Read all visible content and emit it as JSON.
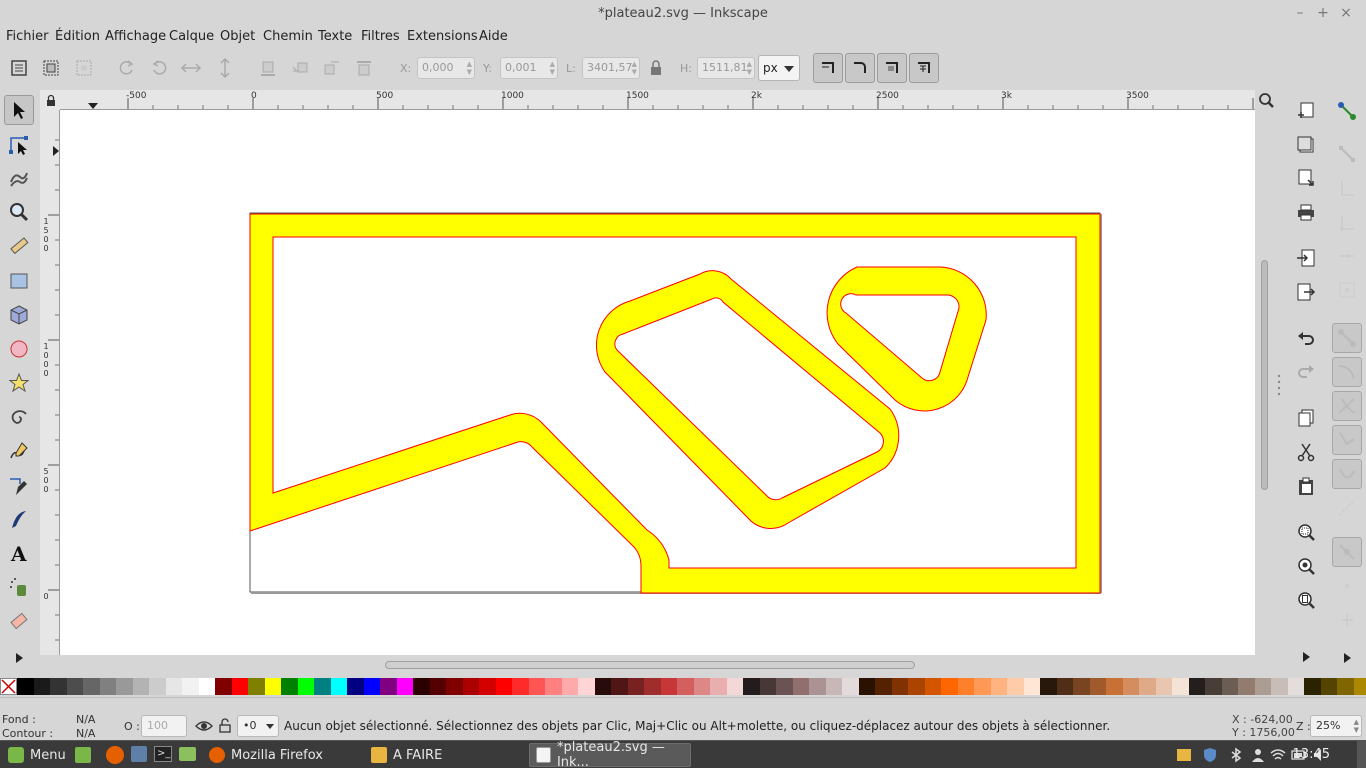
{
  "window": {
    "title": "*plateau2.svg — Inkscape",
    "controls": [
      "–",
      "+",
      "×"
    ]
  },
  "menu": [
    "Fichier",
    "Édition",
    "Affichage",
    "Calque",
    "Objet",
    "Chemin",
    "Texte",
    "Filtres",
    "Extensions",
    "Aide"
  ],
  "toolbar": {
    "x_label": "X:",
    "x_value": "0,000",
    "y_label": "Y:",
    "y_value": "0,001",
    "w_label": "L:",
    "w_value": "3401,57",
    "h_label": "H:",
    "h_value": "1511,81",
    "unit": "px"
  },
  "rulers": {
    "top": [
      "-500",
      "0",
      "500",
      "1000",
      "1500",
      "2k",
      "2500",
      "3k",
      "3500"
    ],
    "left": [
      [
        "1",
        "5",
        "0",
        "0"
      ],
      [
        "1",
        "0",
        "0",
        "0"
      ],
      [
        "5",
        "0",
        "0"
      ],
      [
        "0"
      ]
    ]
  },
  "palette": [
    "#000000",
    "#1a1a1a",
    "#333333",
    "#4d4d4d",
    "#666666",
    "#808080",
    "#999999",
    "#b3b3b3",
    "#cccccc",
    "#e6e6e6",
    "#f2f2f2",
    "#ffffff",
    "#800000",
    "#ff0000",
    "#808000",
    "#ffff00",
    "#008000",
    "#00ff00",
    "#008080",
    "#00ffff",
    "#000080",
    "#0000ff",
    "#800080",
    "#ff00ff",
    "#2b0000",
    "#550000",
    "#800000",
    "#aa0000",
    "#d40000",
    "#ff0000",
    "#ff2a2a",
    "#ff5555",
    "#ff8080",
    "#ffaaaa",
    "#ffd5d5",
    "#280b0b",
    "#501616",
    "#782121",
    "#a02c2c",
    "#c83737",
    "#d35f5f",
    "#de8787",
    "#e9afaf",
    "#f4d7d7",
    "#241c1c",
    "#483737",
    "#6c5353",
    "#916f6f",
    "#ac9393",
    "#c8b7b7",
    "#e3dbdb",
    "#2b1100",
    "#552200",
    "#803300",
    "#aa4400",
    "#d45500",
    "#ff6600",
    "#ff7f2a",
    "#ff9955",
    "#ffb380",
    "#ffccaa",
    "#ffe6d5",
    "#28170b",
    "#502d16",
    "#784421",
    "#a05a2c",
    "#c87137",
    "#d38d5f",
    "#deaa87",
    "#e9c6af",
    "#f4e3d7",
    "#241f1c",
    "#483e37",
    "#6c5d53",
    "#917c6f",
    "#ac9d93",
    "#c8beb7",
    "#e3dedb",
    "#2b2200",
    "#554400",
    "#806600",
    "#aa8800"
  ],
  "status": {
    "fill_label": "Fond :",
    "fill_value": "N/A",
    "stroke_label": "Contour :",
    "stroke_value": "N/A",
    "opacity_label": "O :",
    "opacity_value": "100",
    "layer_value": "•0",
    "message": "Aucun objet sélectionné. Sélectionnez des objets par Clic, Maj+Clic ou Alt+molette, ou cliquez-déplacez autour des objets à sélectionner.",
    "x_readout": "X : -624,00",
    "y_readout": "Y : 1756,00",
    "zoom_label": "Z :",
    "zoom_value": "25%"
  },
  "taskbar": {
    "menu_label": "Menu",
    "tasks": [
      "Mozilla Firefox",
      "A FAIRE",
      "*plateau2.svg — Ink..."
    ],
    "clock": "13:45"
  },
  "drawing": {
    "track_fill": "#ffff00",
    "track_stroke": "#ff0000"
  }
}
